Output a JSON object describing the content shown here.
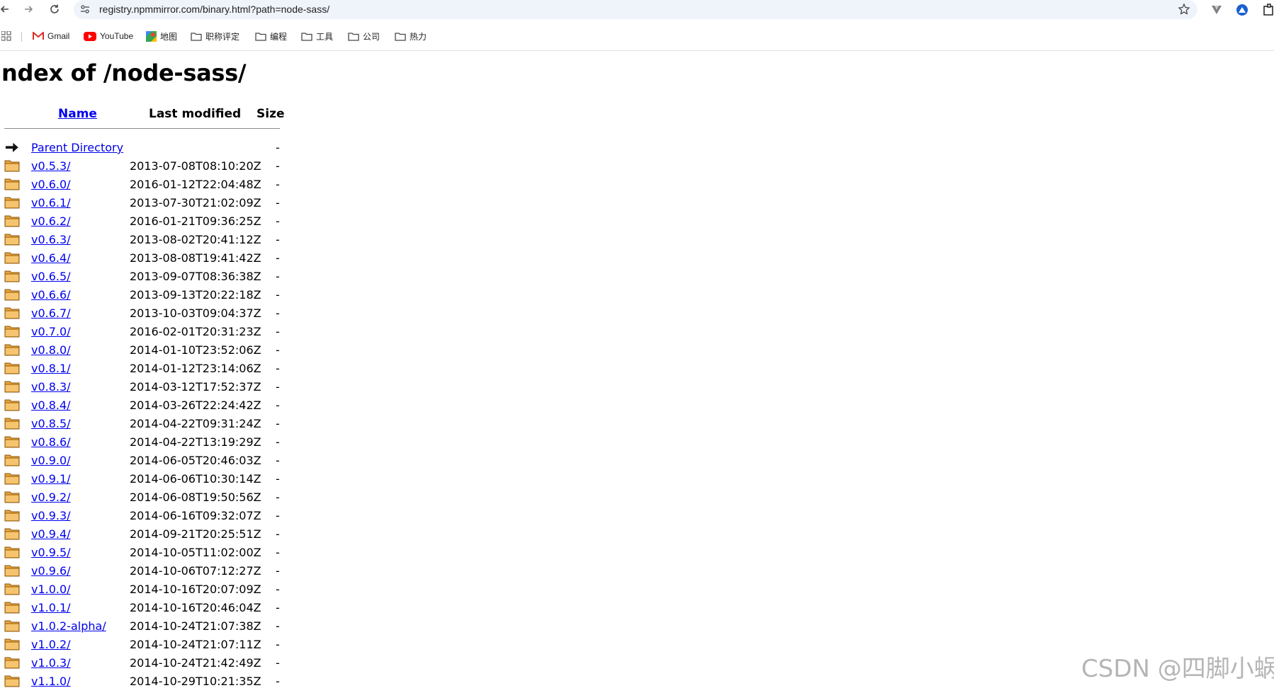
{
  "browser": {
    "url": "registry.npmmirror.com/binary.html?path=node-sass/"
  },
  "bookmarks": [
    {
      "label": "Gmail",
      "icon": "gmail-icon"
    },
    {
      "label": "YouTube",
      "icon": "youtube-icon"
    },
    {
      "label": "地图",
      "icon": "maps-icon"
    },
    {
      "label": "职称评定",
      "icon": "folder-icon"
    },
    {
      "label": "编程",
      "icon": "folder-icon"
    },
    {
      "label": "工具",
      "icon": "folder-icon"
    },
    {
      "label": "公司",
      "icon": "folder-icon"
    },
    {
      "label": "热力",
      "icon": "folder-icon"
    }
  ],
  "page": {
    "title": "ndex of /node-sass/",
    "columns": {
      "name": "Name",
      "last_modified": "Last modified",
      "size": "Size"
    },
    "parent": {
      "label": "Parent Directory",
      "size": "-"
    },
    "entries": [
      {
        "name": "v0.5.3/",
        "modified": "2013-07-08T08:10:20Z",
        "size": "-"
      },
      {
        "name": "v0.6.0/",
        "modified": "2016-01-12T22:04:48Z",
        "size": "-"
      },
      {
        "name": "v0.6.1/",
        "modified": "2013-07-30T21:02:09Z",
        "size": "-"
      },
      {
        "name": "v0.6.2/",
        "modified": "2016-01-21T09:36:25Z",
        "size": "-"
      },
      {
        "name": "v0.6.3/",
        "modified": "2013-08-02T20:41:12Z",
        "size": "-"
      },
      {
        "name": "v0.6.4/",
        "modified": "2013-08-08T19:41:42Z",
        "size": "-"
      },
      {
        "name": "v0.6.5/",
        "modified": "2013-09-07T08:36:38Z",
        "size": "-"
      },
      {
        "name": "v0.6.6/",
        "modified": "2013-09-13T20:22:18Z",
        "size": "-"
      },
      {
        "name": "v0.6.7/",
        "modified": "2013-10-03T09:04:37Z",
        "size": "-"
      },
      {
        "name": "v0.7.0/",
        "modified": "2016-02-01T20:31:23Z",
        "size": "-"
      },
      {
        "name": "v0.8.0/",
        "modified": "2014-01-10T23:52:06Z",
        "size": "-"
      },
      {
        "name": "v0.8.1/",
        "modified": "2014-01-12T23:14:06Z",
        "size": "-"
      },
      {
        "name": "v0.8.3/",
        "modified": "2014-03-12T17:52:37Z",
        "size": "-"
      },
      {
        "name": "v0.8.4/",
        "modified": "2014-03-26T22:24:42Z",
        "size": "-"
      },
      {
        "name": "v0.8.5/",
        "modified": "2014-04-22T09:31:24Z",
        "size": "-"
      },
      {
        "name": "v0.8.6/",
        "modified": "2014-04-22T13:19:29Z",
        "size": "-"
      },
      {
        "name": "v0.9.0/",
        "modified": "2014-06-05T20:46:03Z",
        "size": "-"
      },
      {
        "name": "v0.9.1/",
        "modified": "2014-06-06T10:30:14Z",
        "size": "-"
      },
      {
        "name": "v0.9.2/",
        "modified": "2014-06-08T19:50:56Z",
        "size": "-"
      },
      {
        "name": "v0.9.3/",
        "modified": "2014-06-16T09:32:07Z",
        "size": "-"
      },
      {
        "name": "v0.9.4/",
        "modified": "2014-09-21T20:25:51Z",
        "size": "-"
      },
      {
        "name": "v0.9.5/",
        "modified": "2014-10-05T11:02:00Z",
        "size": "-"
      },
      {
        "name": "v0.9.6/",
        "modified": "2014-10-06T07:12:27Z",
        "size": "-"
      },
      {
        "name": "v1.0.0/",
        "modified": "2014-10-16T20:07:09Z",
        "size": "-"
      },
      {
        "name": "v1.0.1/",
        "modified": "2014-10-16T20:46:04Z",
        "size": "-"
      },
      {
        "name": "v1.0.2-alpha/",
        "modified": "2014-10-24T21:07:38Z",
        "size": "-"
      },
      {
        "name": "v1.0.2/",
        "modified": "2014-10-24T21:07:11Z",
        "size": "-"
      },
      {
        "name": "v1.0.3/",
        "modified": "2014-10-24T21:42:49Z",
        "size": "-"
      },
      {
        "name": "v1.1.0/",
        "modified": "2014-10-29T10:21:35Z",
        "size": "-"
      }
    ]
  },
  "watermark": "CSDN @四脚小蜗",
  "colors": {
    "link": "#0000ee",
    "folder": "#e8a33d",
    "omnibox_bg": "#eff3fa"
  }
}
